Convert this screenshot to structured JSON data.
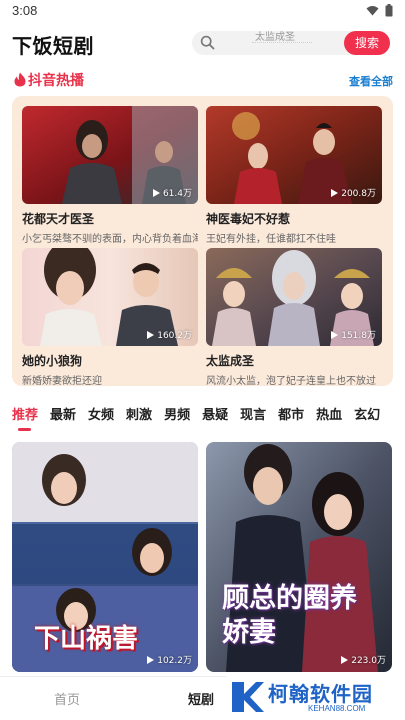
{
  "status": {
    "time": "3:08"
  },
  "header": {
    "app_title": "下饭短剧",
    "search_placeholder": "太监成圣",
    "search_button": "搜索"
  },
  "hot": {
    "title": "抖音热播",
    "view_all": "查看全部",
    "cards": [
      {
        "title": "花都天才医圣",
        "desc": "小乞丐桀骜不驯的表面，内心背负着血海深仇",
        "plays": "61.4万"
      },
      {
        "title": "神医毒妃不好惹",
        "desc": "王妃有外挂，任谁都扛不住哇",
        "plays": "200.8万"
      },
      {
        "title": "她的小狼狗",
        "desc": "新婚娇妻欲拒还迎",
        "plays": "160.2万"
      },
      {
        "title": "太监成圣",
        "desc": "风流小太监，泡了妃子连皇上也不放过",
        "plays": "151.8万"
      }
    ]
  },
  "tabs": [
    "推荐",
    "最新",
    "女频",
    "刺激",
    "男频",
    "悬疑",
    "现言",
    "都市",
    "热血",
    "玄幻"
  ],
  "grid": [
    {
      "overlay": "下山祸害",
      "plays": "102.2万"
    },
    {
      "overlay": "顾总的圈养娇妻",
      "plays": "223.0万"
    }
  ],
  "bottom_nav": [
    {
      "label": "首页"
    },
    {
      "label": "短剧"
    }
  ],
  "watermark": {
    "name": "柯翰软件园",
    "url": "KEHAN88.COM"
  },
  "colors": {
    "accent": "#e8314a",
    "search_button": "#f0304d",
    "hot_panel": "#fbe9da",
    "link": "#1a7fd0"
  }
}
